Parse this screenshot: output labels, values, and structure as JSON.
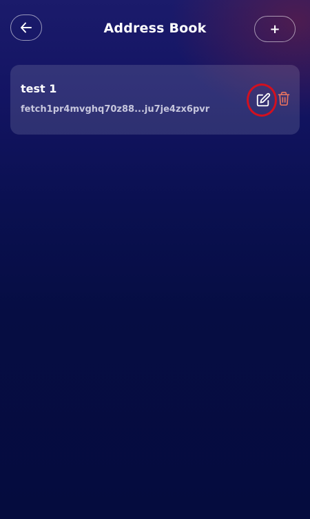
{
  "header": {
    "title": "Address Book",
    "back_icon": "arrow-left-icon",
    "add_label": "+"
  },
  "entries": [
    {
      "name": "test 1",
      "address": "fetch1pr4mvghq70z88...ju7je4zx6pvr",
      "edit_icon": "edit-icon",
      "delete_icon": "trash-icon"
    }
  ],
  "colors": {
    "delete_icon": "#e8735f",
    "highlight_ring": "#d3101f"
  }
}
